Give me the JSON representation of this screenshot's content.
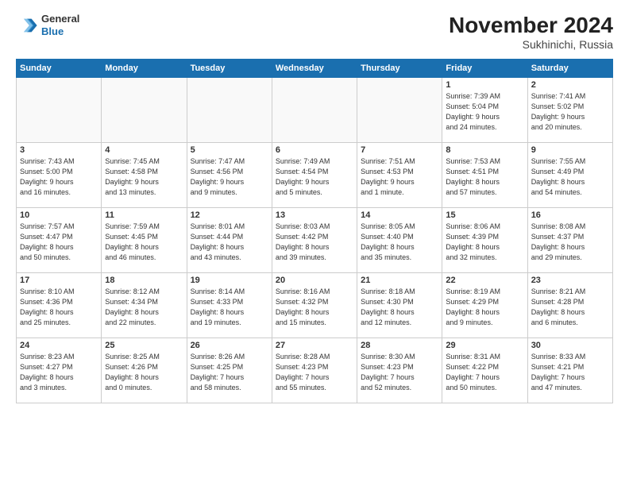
{
  "header": {
    "logo_line1": "General",
    "logo_line2": "Blue",
    "title": "November 2024",
    "subtitle": "Sukhinichi, Russia"
  },
  "weekdays": [
    "Sunday",
    "Monday",
    "Tuesday",
    "Wednesday",
    "Thursday",
    "Friday",
    "Saturday"
  ],
  "weeks": [
    [
      {
        "day": "",
        "info": ""
      },
      {
        "day": "",
        "info": ""
      },
      {
        "day": "",
        "info": ""
      },
      {
        "day": "",
        "info": ""
      },
      {
        "day": "",
        "info": ""
      },
      {
        "day": "1",
        "info": "Sunrise: 7:39 AM\nSunset: 5:04 PM\nDaylight: 9 hours\nand 24 minutes."
      },
      {
        "day": "2",
        "info": "Sunrise: 7:41 AM\nSunset: 5:02 PM\nDaylight: 9 hours\nand 20 minutes."
      }
    ],
    [
      {
        "day": "3",
        "info": "Sunrise: 7:43 AM\nSunset: 5:00 PM\nDaylight: 9 hours\nand 16 minutes."
      },
      {
        "day": "4",
        "info": "Sunrise: 7:45 AM\nSunset: 4:58 PM\nDaylight: 9 hours\nand 13 minutes."
      },
      {
        "day": "5",
        "info": "Sunrise: 7:47 AM\nSunset: 4:56 PM\nDaylight: 9 hours\nand 9 minutes."
      },
      {
        "day": "6",
        "info": "Sunrise: 7:49 AM\nSunset: 4:54 PM\nDaylight: 9 hours\nand 5 minutes."
      },
      {
        "day": "7",
        "info": "Sunrise: 7:51 AM\nSunset: 4:53 PM\nDaylight: 9 hours\nand 1 minute."
      },
      {
        "day": "8",
        "info": "Sunrise: 7:53 AM\nSunset: 4:51 PM\nDaylight: 8 hours\nand 57 minutes."
      },
      {
        "day": "9",
        "info": "Sunrise: 7:55 AM\nSunset: 4:49 PM\nDaylight: 8 hours\nand 54 minutes."
      }
    ],
    [
      {
        "day": "10",
        "info": "Sunrise: 7:57 AM\nSunset: 4:47 PM\nDaylight: 8 hours\nand 50 minutes."
      },
      {
        "day": "11",
        "info": "Sunrise: 7:59 AM\nSunset: 4:45 PM\nDaylight: 8 hours\nand 46 minutes."
      },
      {
        "day": "12",
        "info": "Sunrise: 8:01 AM\nSunset: 4:44 PM\nDaylight: 8 hours\nand 43 minutes."
      },
      {
        "day": "13",
        "info": "Sunrise: 8:03 AM\nSunset: 4:42 PM\nDaylight: 8 hours\nand 39 minutes."
      },
      {
        "day": "14",
        "info": "Sunrise: 8:05 AM\nSunset: 4:40 PM\nDaylight: 8 hours\nand 35 minutes."
      },
      {
        "day": "15",
        "info": "Sunrise: 8:06 AM\nSunset: 4:39 PM\nDaylight: 8 hours\nand 32 minutes."
      },
      {
        "day": "16",
        "info": "Sunrise: 8:08 AM\nSunset: 4:37 PM\nDaylight: 8 hours\nand 29 minutes."
      }
    ],
    [
      {
        "day": "17",
        "info": "Sunrise: 8:10 AM\nSunset: 4:36 PM\nDaylight: 8 hours\nand 25 minutes."
      },
      {
        "day": "18",
        "info": "Sunrise: 8:12 AM\nSunset: 4:34 PM\nDaylight: 8 hours\nand 22 minutes."
      },
      {
        "day": "19",
        "info": "Sunrise: 8:14 AM\nSunset: 4:33 PM\nDaylight: 8 hours\nand 19 minutes."
      },
      {
        "day": "20",
        "info": "Sunrise: 8:16 AM\nSunset: 4:32 PM\nDaylight: 8 hours\nand 15 minutes."
      },
      {
        "day": "21",
        "info": "Sunrise: 8:18 AM\nSunset: 4:30 PM\nDaylight: 8 hours\nand 12 minutes."
      },
      {
        "day": "22",
        "info": "Sunrise: 8:19 AM\nSunset: 4:29 PM\nDaylight: 8 hours\nand 9 minutes."
      },
      {
        "day": "23",
        "info": "Sunrise: 8:21 AM\nSunset: 4:28 PM\nDaylight: 8 hours\nand 6 minutes."
      }
    ],
    [
      {
        "day": "24",
        "info": "Sunrise: 8:23 AM\nSunset: 4:27 PM\nDaylight: 8 hours\nand 3 minutes."
      },
      {
        "day": "25",
        "info": "Sunrise: 8:25 AM\nSunset: 4:26 PM\nDaylight: 8 hours\nand 0 minutes."
      },
      {
        "day": "26",
        "info": "Sunrise: 8:26 AM\nSunset: 4:25 PM\nDaylight: 7 hours\nand 58 minutes."
      },
      {
        "day": "27",
        "info": "Sunrise: 8:28 AM\nSunset: 4:23 PM\nDaylight: 7 hours\nand 55 minutes."
      },
      {
        "day": "28",
        "info": "Sunrise: 8:30 AM\nSunset: 4:23 PM\nDaylight: 7 hours\nand 52 minutes."
      },
      {
        "day": "29",
        "info": "Sunrise: 8:31 AM\nSunset: 4:22 PM\nDaylight: 7 hours\nand 50 minutes."
      },
      {
        "day": "30",
        "info": "Sunrise: 8:33 AM\nSunset: 4:21 PM\nDaylight: 7 hours\nand 47 minutes."
      }
    ]
  ]
}
